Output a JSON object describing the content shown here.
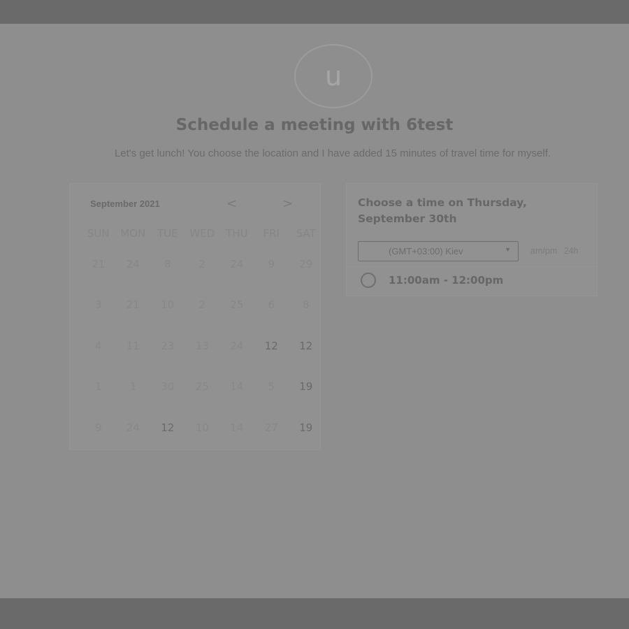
{
  "host": {
    "avatar_initial": "u",
    "title": "Schedule a meeting with 6test",
    "description": "Let's get lunch! You choose the location and I have added 15 minutes of travel time for myself."
  },
  "calendar": {
    "month_label": "September 2021",
    "prev_label": "<",
    "next_label": ">",
    "days_of_week": [
      "SUN",
      "MON",
      "TUE",
      "WED",
      "THU",
      "FRI",
      "SAT"
    ],
    "weeks": [
      [
        "21",
        "24",
        "8",
        "2",
        "24",
        "9",
        "29"
      ],
      [
        "3",
        "21",
        "10",
        "2",
        "25",
        "6",
        "8"
      ],
      [
        "4",
        "11",
        "23",
        "13",
        "24",
        "12",
        "12"
      ],
      [
        "1",
        "1",
        "30",
        "25",
        "14",
        "5",
        "19"
      ],
      [
        "9",
        "24",
        "12",
        "10",
        "14",
        "27",
        "19"
      ]
    ],
    "available_days": [
      [
        2,
        5
      ],
      [
        2,
        6
      ],
      [
        3,
        6
      ],
      [
        4,
        2
      ],
      [
        4,
        6
      ]
    ]
  },
  "time_picker": {
    "heading": "Choose a time on Thursday, September 30th",
    "timezone": "(GMT+03:00) Kiev",
    "format_ampm": "am/pm",
    "format_24h": "24h",
    "slots": [
      "11:00am - 12:00pm"
    ]
  }
}
